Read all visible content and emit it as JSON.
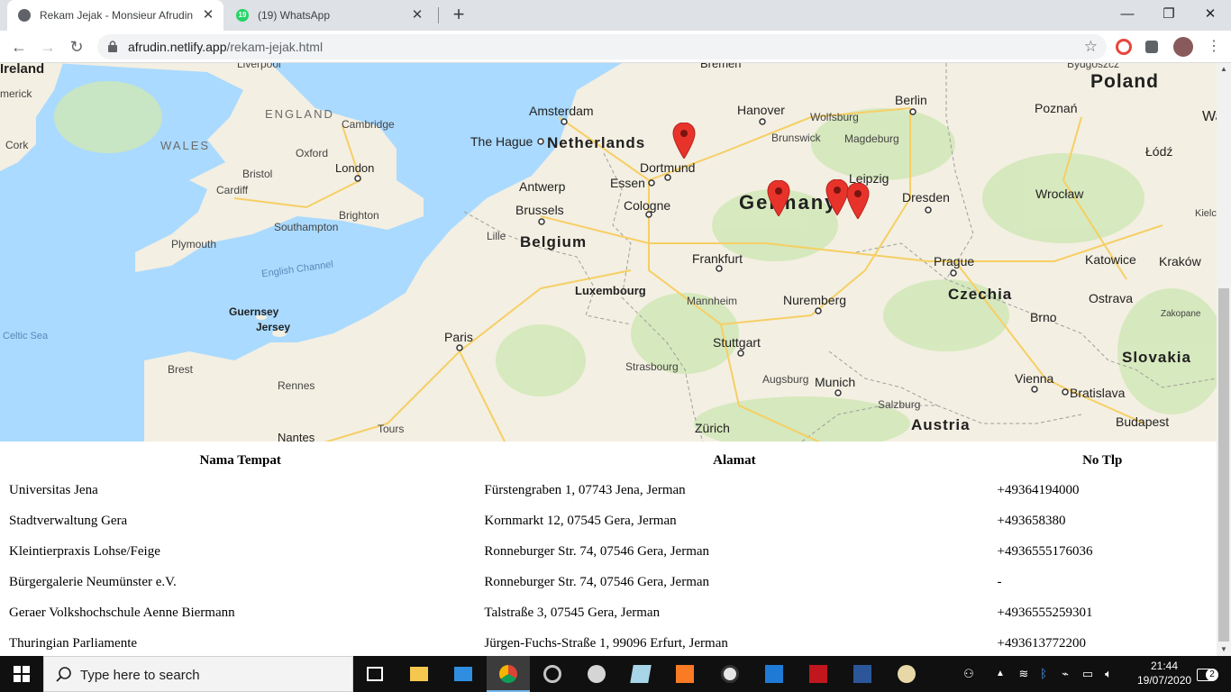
{
  "browser": {
    "tabs": [
      {
        "title": "Rekam Jejak - Monsieur Afrudin",
        "active": true
      },
      {
        "title": "(19) WhatsApp",
        "active": false,
        "badge": "19"
      }
    ],
    "close_glyph": "✕",
    "new_tab_glyph": "+",
    "window_controls": {
      "minimize": "—",
      "restore": "❐",
      "close": "✕"
    },
    "url_host": "afrudin.netlify.app",
    "url_path": "/rekam-jejak.html",
    "nav": {
      "back": "←",
      "forward": "→",
      "reload": "↻",
      "bookmark": "☆"
    }
  },
  "map": {
    "labels": {
      "ireland": "Ireland",
      "merick": "merick",
      "cork": "Cork",
      "liverpool": "Liverpool",
      "england": "ENGLAND",
      "wales": "WALES",
      "cambridge": "Cambridge",
      "oxford": "Oxford",
      "bristol": "Bristol",
      "london": "London",
      "cardiff": "Cardiff",
      "brighton": "Brighton",
      "southampton": "Southampton",
      "plymouth": "Plymouth",
      "english_channel": "English Channel",
      "guernsey": "Guernsey",
      "jersey": "Jersey",
      "celtic_sea": "Celtic Sea",
      "brest": "Brest",
      "rennes": "Rennes",
      "nantes": "Nantes",
      "tours": "Tours",
      "paris": "Paris",
      "lille": "Lille",
      "the_hague": "The Hague",
      "amsterdam": "Amsterdam",
      "netherlands": "Netherlands",
      "antwerp": "Antwerp",
      "brussels": "Brussels",
      "belgium": "Belgium",
      "luxembourg": "Luxembourg",
      "strasbourg": "Strasbourg",
      "zurich": "Zürich",
      "bremen": "Bremen",
      "hanover": "Hanover",
      "wolfsburg": "Wolfsburg",
      "brunswick": "Brunswick",
      "magdeburg": "Magdeburg",
      "dortmund": "Dortmund",
      "essen": "Essen",
      "cologne": "Cologne",
      "germany": "Germany",
      "leipzig": "Leipzig",
      "dresden": "Dresden",
      "berlin": "Berlin",
      "frankfurt": "Frankfurt",
      "mannheim": "Mannheim",
      "nuremberg": "Nuremberg",
      "stuttgart": "Stuttgart",
      "augsburg": "Augsburg",
      "munich": "Munich",
      "salzburg": "Salzburg",
      "austria": "Austria",
      "vienna": "Vienna",
      "bratislava": "Bratislava",
      "slovakia": "Slovakia",
      "budapest": "Budapest",
      "czechia": "Czechia",
      "prague": "Prague",
      "brno": "Brno",
      "ostrava": "Ostrava",
      "zakopane": "Zakopane",
      "katowice": "Katowice",
      "krakow": "Kraków",
      "wroclaw": "Wrocław",
      "poznan": "Poznań",
      "lodz": "Łódź",
      "poland": "Poland",
      "bydgoszcz": "Bydgoszcz",
      "kielce": "Kielc",
      "wa": "Wa"
    },
    "marker_color": "#e8332b"
  },
  "table": {
    "headers": [
      "Nama Tempat",
      "Alamat",
      "No Tlp"
    ],
    "rows": [
      [
        "Universitas Jena",
        "Fürstengraben 1, 07743 Jena, Jerman",
        "+49364194000"
      ],
      [
        "Stadtverwaltung Gera",
        "Kornmarkt 12, 07545 Gera, Jerman",
        "+493658380"
      ],
      [
        "Kleintierpraxis Lohse/Feige",
        "Ronneburger Str. 74, 07546 Gera, Jerman",
        "+4936555176036"
      ],
      [
        "Bürgergalerie Neumünster e.V.",
        "Ronneburger Str. 74, 07546 Gera, Jerman",
        "-"
      ],
      [
        "Geraer Volkshochschule Aenne Biermann",
        "Talstraße 3, 07545 Gera, Jerman",
        "+4936555259301"
      ],
      [
        "Thuringian Parliamente",
        "Jürgen-Fuchs-Straße 1, 99096 Erfurt, Jerman",
        "+493613772200"
      ]
    ]
  },
  "taskbar": {
    "search_placeholder": "Type here to search",
    "time": "21:44",
    "date": "19/07/2020",
    "notification_count": "2"
  }
}
